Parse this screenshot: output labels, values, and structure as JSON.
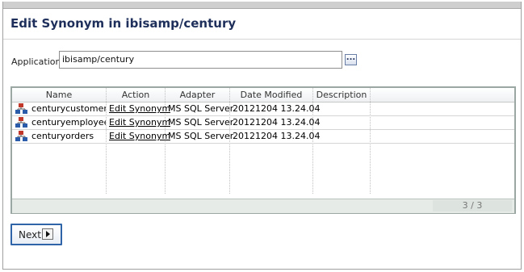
{
  "page": {
    "title": "Edit Synonym in ibisamp/century"
  },
  "application": {
    "label": "Application",
    "value": "ibisamp/century",
    "browse_label": "..."
  },
  "grid": {
    "columns": [
      "Name",
      "Action",
      "Adapter",
      "Date Modified",
      "Description"
    ],
    "rows": [
      {
        "name": "centurycustomers",
        "action": "Edit Synonym",
        "adapter": "MS SQL Server",
        "date_modified": "20121204 13.24.04",
        "description": ""
      },
      {
        "name": "centuryemployees",
        "action": "Edit Synonym",
        "adapter": "MS SQL Server",
        "date_modified": "20121204 13.24.04",
        "description": ""
      },
      {
        "name": "centuryorders",
        "action": "Edit Synonym",
        "adapter": "MS SQL Server",
        "date_modified": "20121204 13.24.04",
        "description": ""
      }
    ],
    "pager": "3 / 3"
  },
  "buttons": {
    "next_label": "Next"
  },
  "icons": {
    "row_icon": "synonym-table-icon",
    "next_icon": "play-arrow-icon"
  },
  "colors": {
    "title": "#1d2f5a",
    "next_border": "#2f65a8"
  }
}
